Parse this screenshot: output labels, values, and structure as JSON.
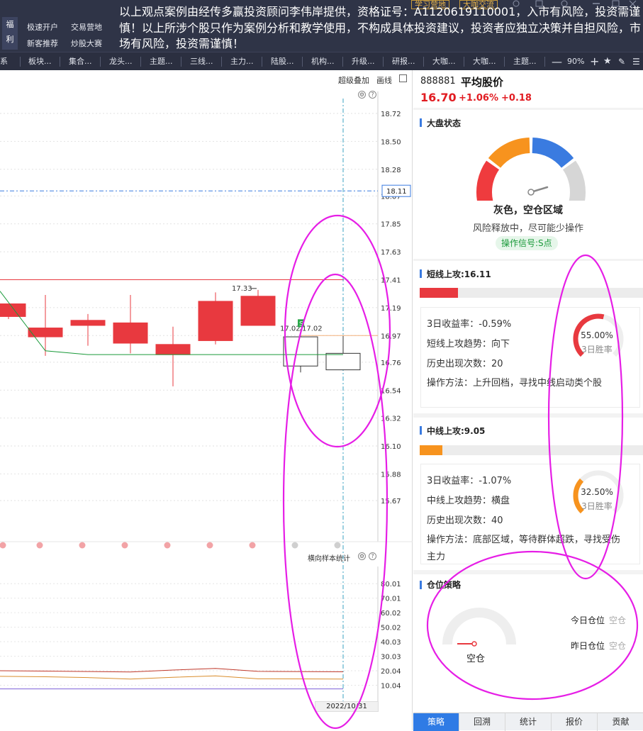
{
  "topbar": {
    "fuli": [
      "福",
      "利"
    ],
    "buttons": [
      "极速开户",
      "交易营地",
      "新客推荐",
      "炒股大赛"
    ],
    "notice": "以上观点案例由经传多赢投资顾问李伟岸提供，资格证号：A1120619110001，入市有风险，投资需谨慎！以上所涉个股只作为案例分析和教学使用，不构成具体投资建议，投资者应独立决策并自担风险，市场有风险，投资需谨慎！",
    "yellow_buttons": [
      "学习营地",
      "大咖交流"
    ]
  },
  "tabs": [
    "板块...",
    "集合...",
    "龙头...",
    "主题...",
    "三线...",
    "主力...",
    "陆股...",
    "机构...",
    "升级...",
    "研报...",
    "大咖...",
    "大咖...",
    "主题..."
  ],
  "tab_first_partial": "系",
  "zoom": "90%",
  "chart": {
    "toolbar": {
      "overlay": "超级叠加",
      "draw": "画线"
    },
    "price_ticks": [
      "18.72",
      "18.50",
      "18.28",
      "18.07",
      "17.85",
      "17.63",
      "17.41",
      "17.19",
      "16.97",
      "16.76",
      "16.54",
      "16.32",
      "16.10",
      "15.88",
      "15.67"
    ],
    "price_marker": "18.11",
    "candle_labels": {
      "high": "17.33",
      "low_a": "17.02",
      "low_b": "17.02",
      "badge": "S"
    },
    "lower_title": "横向样本统计",
    "lower_ticks": [
      "80.01",
      "70.01",
      "60.02",
      "50.02",
      "40.03",
      "30.03",
      "20.04",
      "10.04"
    ],
    "date": "2022/10/31"
  },
  "chart_data": {
    "type": "candlestick",
    "candles": [
      {
        "open": 17.12,
        "close": 17.22,
        "high": 17.22,
        "low": 17.1,
        "color": "#e8393f"
      },
      {
        "open": 17.03,
        "close": 16.96,
        "high": 17.29,
        "low": 16.81,
        "color": "#e8393f"
      },
      {
        "open": 17.05,
        "close": 17.09,
        "high": 17.14,
        "low": 16.89,
        "color": "#e8393f"
      },
      {
        "open": 16.91,
        "close": 17.07,
        "high": 17.29,
        "low": 16.83,
        "color": "#e8393f"
      },
      {
        "open": 16.82,
        "close": 16.9,
        "high": 17.04,
        "low": 16.57,
        "color": "#e8393f"
      },
      {
        "open": 16.93,
        "close": 17.24,
        "high": 17.31,
        "low": 16.9,
        "color": "#e8393f"
      },
      {
        "open": 17.05,
        "close": 17.28,
        "high": 17.33,
        "low": 17.05,
        "color": "#e8393f"
      },
      {
        "open": 16.96,
        "close": 16.73,
        "high": 17.02,
        "low": 16.68,
        "color": "hollow"
      },
      {
        "open": 16.83,
        "close": 16.7,
        "high": 16.97,
        "low": 16.7,
        "color": "hollow"
      }
    ],
    "ylim": [
      15.67,
      18.72
    ],
    "resistance_line": 17.41,
    "dashed_line": 18.11,
    "green_line": [
      17.32,
      16.85,
      16.82,
      16.82,
      16.82,
      16.82,
      16.82,
      16.82
    ],
    "lower_series": [
      {
        "color": "#c0392b",
        "values": [
          20.0,
          19.8,
          19.5,
          19.2,
          20.5,
          21.6,
          19.6,
          19.3
        ]
      },
      {
        "color": "#d98d2c",
        "values": [
          16.2,
          15.9,
          15.3,
          14.3,
          15.5,
          16.5,
          14.5,
          14.3
        ]
      },
      {
        "color": "#7b5fd9",
        "values": [
          7.5,
          7.5,
          7.5,
          7.5,
          7.5,
          7.5,
          7.5,
          7.5
        ]
      }
    ],
    "lower_ylim": [
      0,
      85
    ]
  },
  "panel": {
    "code": "888881",
    "name": "平均股价",
    "price": "16.70",
    "pct": "+1.06%",
    "chg": "+0.18",
    "market": {
      "title": "大盘状态",
      "status": "灰色，空仓区域",
      "desc": "风险释放中，尽可能少操作",
      "signal": "操作信号:S点"
    },
    "short": {
      "title": "短线上攻:16.11",
      "progress": 0.17,
      "ret": "3日收益率：-0.59%",
      "trend": "短线上攻趋势：向下",
      "count": "历史出现次数：20",
      "method": "操作方法：上升回档，寻找中线启动类个股",
      "win": "55.00%",
      "win_value": 0.55,
      "win_label": "3日胜率"
    },
    "mid": {
      "title": "中线上攻:9.05",
      "progress": 0.1,
      "ret": "3日收益率：-1.07%",
      "trend": "中线上攻趋势：横盘",
      "count": "历史出现次数：40",
      "method": "操作方法：底部区域，等待群体超跌，寻找受伤主力",
      "win": "32.50%",
      "win_value": 0.325,
      "win_label": "3日胜率"
    },
    "position": {
      "title": "仓位策略",
      "gauge_label": "空仓",
      "today_label": "今日仓位",
      "today_value": "空仓",
      "yest_label": "昨日仓位",
      "yest_value": "空仓"
    },
    "bottom_tabs": [
      "策略",
      "回溯",
      "统计",
      "报价",
      "贡献"
    ]
  },
  "colors": {
    "red": "#e8393f",
    "orange": "#f7931e",
    "blue": "#3a7be0",
    "gray": "#d6d6d6",
    "magenta": "#e61ee6",
    "green": "#1a9a3a"
  }
}
